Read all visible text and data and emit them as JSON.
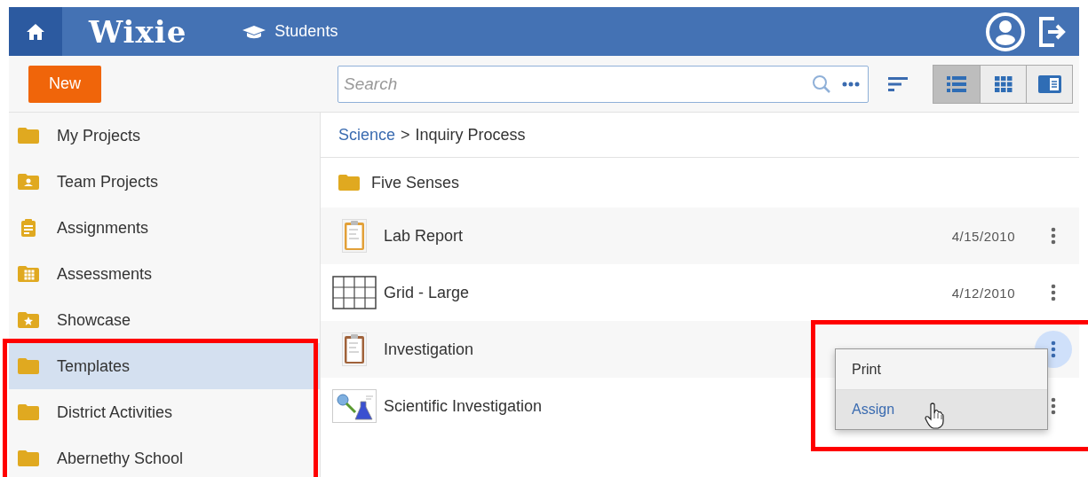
{
  "header": {
    "logo": "Wixie",
    "nav": [
      {
        "label": "Students"
      }
    ]
  },
  "toolbar": {
    "new_button": "New",
    "search": {
      "placeholder": "Search"
    },
    "views": [
      {
        "kind": "list",
        "selected": true
      },
      {
        "kind": "grid",
        "selected": false
      },
      {
        "kind": "detail",
        "selected": false
      }
    ]
  },
  "sidebar": {
    "highlighted": true,
    "items": [
      {
        "label": "My Projects",
        "kind": "folder",
        "selected": false
      },
      {
        "label": "Team Projects",
        "kind": "team",
        "selected": false
      },
      {
        "label": "Assignments",
        "kind": "assignment",
        "selected": false
      },
      {
        "label": "Assessments",
        "kind": "assessment",
        "selected": false
      },
      {
        "label": "Showcase",
        "kind": "showcase",
        "selected": false
      },
      {
        "label": "Templates",
        "kind": "folder",
        "selected": true
      },
      {
        "label": "District Activities",
        "kind": "folder",
        "selected": false
      },
      {
        "label": "Abernethy School",
        "kind": "folder",
        "selected": false
      }
    ]
  },
  "breadcrumb": {
    "link": "Science",
    "separator": ">",
    "current": "Inquiry Process"
  },
  "files": [
    {
      "kind": "folder",
      "name": "Five Senses"
    },
    {
      "kind": "clipboard",
      "name": "Lab Report",
      "date": "4/15/2010",
      "menu_open": false
    },
    {
      "kind": "grid",
      "name": "Grid - Large",
      "date": "4/12/2010",
      "menu_open": false
    },
    {
      "kind": "clipboard",
      "name": "Investigation",
      "menu_open": true
    },
    {
      "kind": "science",
      "name": "Scientific Investigation",
      "menu_open": false
    }
  ],
  "menu": {
    "highlighted": true,
    "items": [
      {
        "label": "Print",
        "hovered": false
      },
      {
        "label": "Assign",
        "hovered": true
      }
    ]
  }
}
